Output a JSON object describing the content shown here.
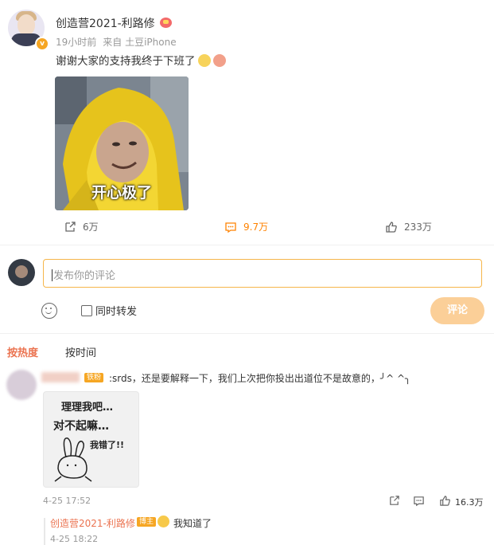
{
  "post": {
    "author": "创造营2021-利路修",
    "time": "19小时前",
    "source": "来自 土豆iPhone",
    "text": "谢谢大家的支持我终于下班了",
    "image_caption": "开心极了",
    "reposts": "6万",
    "comments": "9.7万",
    "likes": "233万"
  },
  "composer": {
    "placeholder": "发布你的评论",
    "repost_label": "同时转发",
    "submit_label": "评论"
  },
  "sort_tabs": [
    "按热度",
    "按时间"
  ],
  "comments": [
    {
      "badge": "铁粉",
      "text": ":srds，还是要解释一下，我们上次把你投出出道位不是故意的，╯^ ^╮",
      "sticker_text": [
        "理理我吧…",
        "对不起嘛…",
        "我错了!!"
      ],
      "time": "4-25 17:52",
      "likes": "16.3万",
      "reply": {
        "author": "创造营2021-利路修",
        "badge": "博主",
        "text": "我知道了",
        "time": "4-25 18:22"
      }
    }
  ],
  "colors": {
    "accent": "#ff8200",
    "tab_active": "#eb7350",
    "submit_bg": "#fbcf98",
    "input_border": "#f6b64a"
  }
}
